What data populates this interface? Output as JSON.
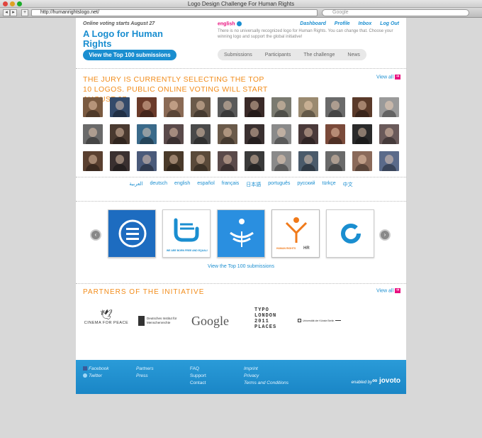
{
  "browser": {
    "window_title": "Logo Design Challenge For Human Rights",
    "url": "http://humanrightslogo.net/",
    "search_placeholder": "Google"
  },
  "header": {
    "notice": "Online voting starts August 27",
    "logo_title": "A Logo for Human Rights",
    "top100_button": "View the Top 100 submissions",
    "language": "english",
    "intro": "There is no universally recognized logo for Human Rights. You can change that. Choose your winning logo and support the global initiative!",
    "user_nav": [
      "Dashboard",
      "Profile",
      "Inbox",
      "Log Out"
    ],
    "main_nav": [
      "Submissions",
      "Participants",
      "The challenge",
      "News"
    ]
  },
  "jury": {
    "heading": "The jury is currently selecting the top 10 logos. Public online voting will start August 27",
    "view_all": "View all",
    "faces": [
      "#7a5a40",
      "#334a6a",
      "#6b3b2a",
      "#8a6a55",
      "#6a5a4a",
      "#5a5a5a",
      "#3a2a28",
      "#7a7a70",
      "#9a8a70",
      "#6a6a6a",
      "#5a3a2a",
      "#9a9a9a",
      "#6a6a6a",
      "#4a3a30",
      "#3a6a8a",
      "#5a4a4a",
      "#4a4a4a",
      "#6a5a4a",
      "#3a3030",
      "#8a8a8a",
      "#4a3a3a",
      "#7a4a3a",
      "#2a2a2a",
      "#6a5a5a",
      "#5a4030",
      "#3a3030",
      "#4a5a7a",
      "#4a3a2a",
      "#5a4a3a",
      "#5a4a4a",
      "#3a3a3a",
      "#8a8a8a",
      "#4a5a6a",
      "#6a6a6a",
      "#8a6a5a",
      "#5a6a8a"
    ]
  },
  "languages": [
    "العربية",
    "deutsch",
    "english",
    "español",
    "français",
    "日本語",
    "português",
    "русский",
    "türkçe",
    "中文"
  ],
  "carousel": {
    "prev": "‹",
    "next": "›",
    "view_top100": "View the Top 100 submissions",
    "card_labels": [
      "WE ARE BORN FREE AND EQUAL!",
      "HUMAN RIGHTS",
      "HR"
    ]
  },
  "partners": {
    "heading": "PARTNERS OF THE INITIATIVE",
    "view_all": "View all",
    "logos": [
      "CINEMA FOR PEACE",
      "Deutsches Institut für Menschenrechte",
      "Google",
      "TYPO LONDON 2011 PLACES",
      "Universität der Künste Berlin"
    ]
  },
  "footer": {
    "social": [
      "Facebook",
      "Twitter"
    ],
    "col2": [
      "Partners",
      "Press"
    ],
    "col3": [
      "FAQ",
      "Support",
      "Contact"
    ],
    "col4": [
      "Imprint",
      "Privacy",
      "Terms and Conditions"
    ],
    "enabled_by": "enabled by",
    "brand": "jovoto"
  },
  "colors": {
    "accent": "#1a8ed0",
    "orange": "#f28c1a",
    "pink": "#e8117f"
  }
}
